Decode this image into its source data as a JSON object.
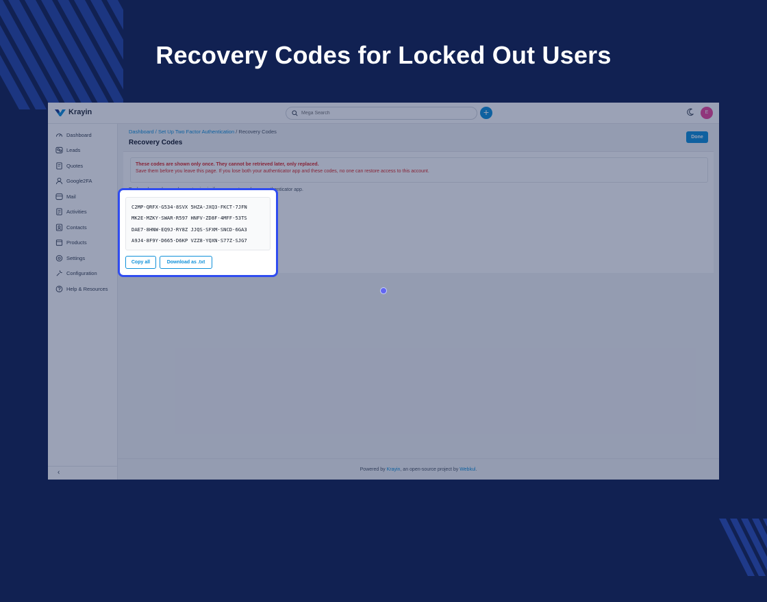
{
  "headline": "Recovery Codes for Locked Out Users",
  "topbar": {
    "logo": "Krayin",
    "search_placeholder": "Mega Search",
    "avatar_initial": "E"
  },
  "sidebar": {
    "items": [
      {
        "label": "Dashboard",
        "icon": "dashboard-icon"
      },
      {
        "label": "Leads",
        "icon": "leads-icon"
      },
      {
        "label": "Quotes",
        "icon": "quotes-icon"
      },
      {
        "label": "Google2FA",
        "icon": "user-icon"
      },
      {
        "label": "Mail",
        "icon": "mail-icon"
      },
      {
        "label": "Activities",
        "icon": "activities-icon"
      },
      {
        "label": "Contacts",
        "icon": "contacts-icon"
      },
      {
        "label": "Products",
        "icon": "products-icon"
      },
      {
        "label": "Settings",
        "icon": "settings-icon"
      },
      {
        "label": "Configuration",
        "icon": "wrench-icon"
      },
      {
        "label": "Help & Resources",
        "icon": "help-icon"
      }
    ],
    "collapse_glyph": "‹"
  },
  "breadcrumb": {
    "dashboard": "Dashboard",
    "separator": " / ",
    "setup": "Set Up Two Factor Authentication",
    "current": "Recovery Codes"
  },
  "page": {
    "title": "Recovery Codes",
    "done_label": "Done",
    "warning_title": "These codes are shown only once. They cannot be retrieved later, only replaced.",
    "warning_sub": "Save them before you leave this page. If you lose both your authenticator app and these codes, no one can restore access to this account.",
    "note": "Each code can be used once to sign in if you cannot reach your authenticator app."
  },
  "codes": [
    "C2MP·QRFX·G534·8SVX  5HZA·JXQ3·FKCT·7JFN",
    "MK2E·MZKY·SWAR·R597  HNFV·ZD8F·4MFF·53TS",
    "DAE7·8HNW·EQ9J·RY8Z  JJQS·SFXM·SNCD·6GA3",
    "A9J4·8F9Y·D665·D6KP  VZZ8·YQXN·S77Z·SJG7"
  ],
  "actions": {
    "copy_all": "Copy all",
    "download": "Download as .txt"
  },
  "footer": {
    "prefix": "Powered by ",
    "krayin": "Krayin",
    "middle": ", an open-source project by ",
    "webkul": "Webkul",
    "suffix": "."
  },
  "colors": {
    "background": "#112152",
    "accent": "#0e90d9",
    "highlight_border": "#2f4cf0",
    "warning": "#dc2626"
  }
}
